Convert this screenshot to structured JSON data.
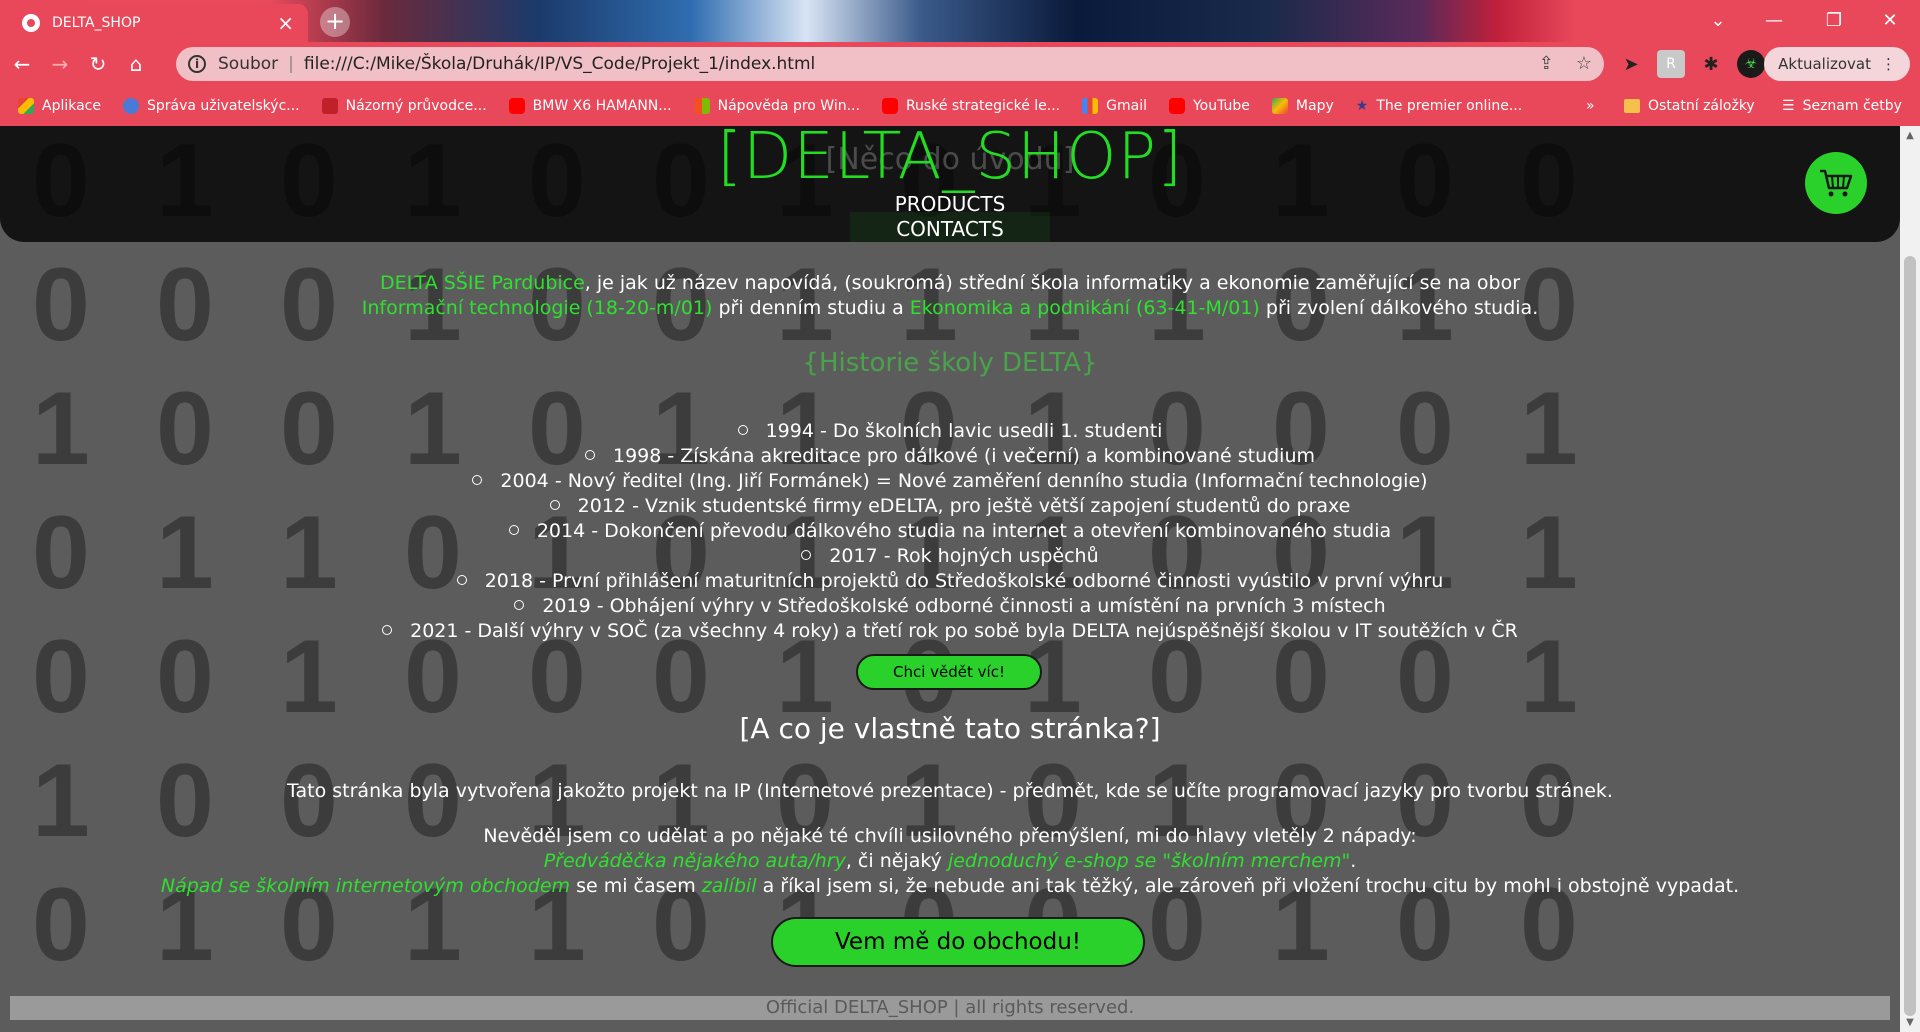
{
  "browser": {
    "tab_title": "DELTA_SHOP",
    "new_tab": "+",
    "omnibox": {
      "scheme_label": "Soubor",
      "url": "file:///C:/Mike/Škola/Druhák/IP/VS_Code/Projekt_1/index.html"
    },
    "update_label": "Aktualizovat",
    "bookmarks": [
      {
        "label": "Aplikace",
        "icon": "apps-grid-icon",
        "color": "#f4b400"
      },
      {
        "label": "Správa uživatelskýc...",
        "icon": "globe-icon",
        "color": "#4a7ad8"
      },
      {
        "label": "Názorný průvodce...",
        "icon": "zive-icon",
        "color": "#c0202a"
      },
      {
        "label": "BMW X6 HAMANN...",
        "icon": "youtube-icon",
        "color": "#ff0000"
      },
      {
        "label": "Nápověda pro Win...",
        "icon": "windows-icon",
        "color": "#00a4ef"
      },
      {
        "label": "Ruské strategické le...",
        "icon": "youtube-icon",
        "color": "#ff0000"
      },
      {
        "label": "Gmail",
        "icon": "gmail-icon",
        "color": "#ea4335"
      },
      {
        "label": "YouTube",
        "icon": "youtube-icon",
        "color": "#ff0000"
      },
      {
        "label": "Mapy",
        "icon": "maps-icon",
        "color": "#34a853"
      },
      {
        "label": "The premier online...",
        "icon": "star-icon",
        "color": "#3a3a8a"
      }
    ],
    "bookmarks_more": "»",
    "other_bookmarks": "Ostatní záložky",
    "reading_list": "Seznam četby"
  },
  "site": {
    "title": "[DELTA_SHOP]",
    "ghost_title": "[Něco do úvodu]",
    "nav": [
      "PRODUCTS",
      "CONTACTS"
    ],
    "intro": {
      "school": "DELTA SŠIE Pardubice",
      "part1": ", je jak už název napovídá, (soukromá) střední škola informatiky a ekonomie zaměřující se na obor",
      "field1": "Informační technologie (18-20-m/01)",
      "part2": " při denním studiu a ",
      "field2": "Ekonomika a podnikání (63-41-M/01)",
      "part3": " při zvolení dálkového studia."
    },
    "history_title": "{Historie školy DELTA}",
    "history": [
      "1994 - Do školních lavic usedli 1. studenti",
      "1998 - Získána akreditace pro dálkové (i večerní) a kombinované studium",
      "2004 - Nový ředitel (Ing. Jiří Formánek) = Nové zaměření denního studia (Informační technologie)",
      "2012 - Vznik studentské firmy eDELTA, pro ještě větší zapojení studentů do praxe",
      "2014 - Dokončení převodu dálkového studia na internet a otevření kombinovaného studia",
      "2017 - Rok hojných uspěchů",
      "2018 - První přihlášení maturitních projektů do Středoškolské odborné činnosti vyústilo v první výhru",
      "2019 - Obhájení výhry v Středoškolské odborné činnosti a umístění na prvních 3 místech",
      "2021 - Další výhry v SOČ (za všechny 4 roky) a třetí rok po sobě byla DELTA nejúspěšnější školou v IT soutěžích v ČR"
    ],
    "more_button": "Chci vědět víc!",
    "about_title": "[A co je vlastně tato stránka?]",
    "about_p1": "Tato stránka byla vytvořena jakožto projekt na IP (Internetové prezentace) - předmět, kde se učíte programovací jazyky pro tvorbu stránek.",
    "about_p2": "Nevěděl jsem co udělat a po nějaké té chvíli usilovného přemýšlení, mi do hlavy vletěly 2 nápady:",
    "idea1": "Předváděčka nějakého auta/hry",
    "idea_mid": ", či nějaký ",
    "idea2": "jednoduchý e-shop se \"školním merchem\"",
    "idea_end": ".",
    "p3_hl1": "Nápad se školním internetovým obchodem",
    "p3_mid1": " se mi časem ",
    "p3_hl2": "zalíbil",
    "p3_rest": " a říkal jsem si, že nebude ani tak těžký, ale zároveň při vložení trochu citu by mohl i obstojně vypadat.",
    "shop_button": "Vem mě do obchodu!",
    "footer": "Official DELTA_SHOP | all rights reserved."
  },
  "colors": {
    "chrome_accent": "#e8485a",
    "brand_green": "#2bd12b",
    "page_background": "#5c5c5c"
  }
}
